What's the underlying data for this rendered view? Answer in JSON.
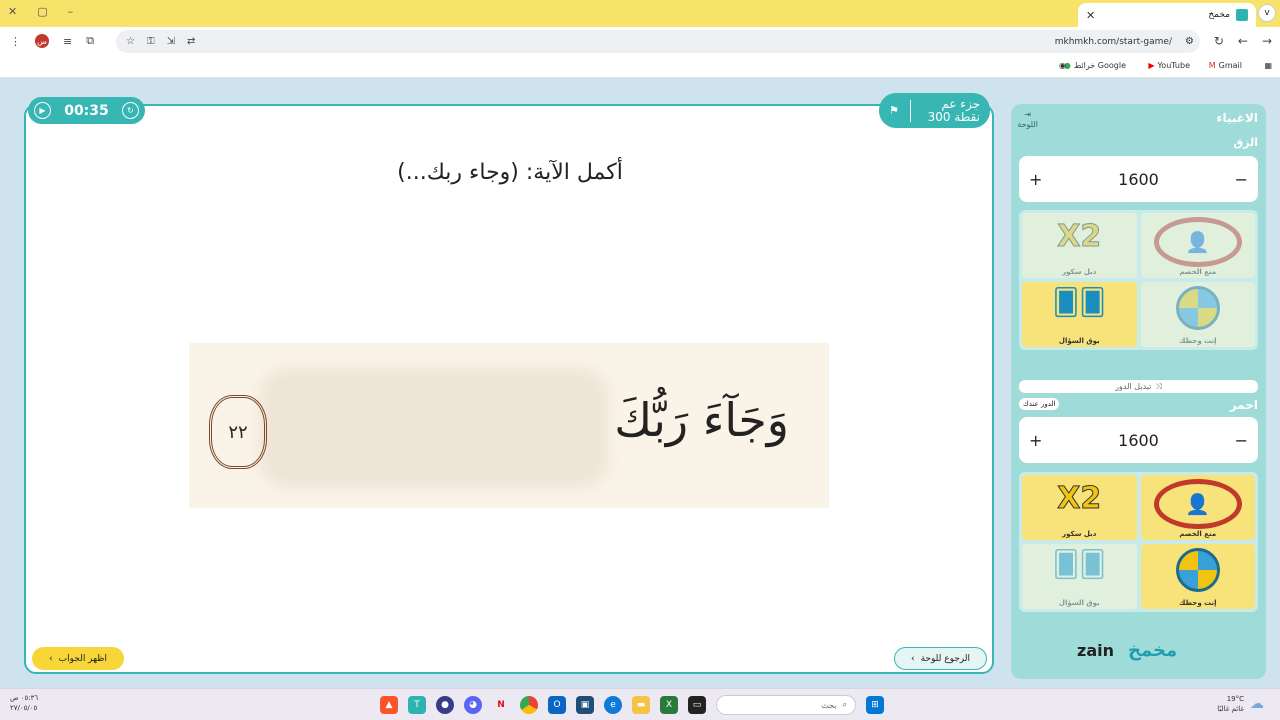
{
  "browser": {
    "tab_title": "مخمخ",
    "tab_profile": "v",
    "url": "mkhmkh.com/start-game/",
    "avatar_letter": "س",
    "bookmarks": [
      {
        "label": "Gmail",
        "icon": "gmail-icon"
      },
      {
        "label": "YouTube",
        "icon": "youtube-icon"
      },
      {
        "label": "خرائط Google",
        "icon": "maps-icon"
      }
    ]
  },
  "game": {
    "timer": "00:35",
    "category_name": "جزء عم",
    "category_points": "300 نقطة",
    "question": "أكمل الآية: (وجاء ربك...)",
    "verse_text": "وَجَآءَ رَبُّكَ",
    "verse_number": "٢٢",
    "show_answer_label": "اظهر الجواب",
    "back_label": "الرجوع للوحة"
  },
  "sidebar": {
    "back_board_label": "اللوحة",
    "team1": {
      "name": "الاغبياء",
      "subtitle": "الزق",
      "score": "1600",
      "aids": [
        {
          "label": "دبل سكور",
          "icon": "x2-icon",
          "used": true
        },
        {
          "label": "منع الخصم",
          "icon": "block-opponent-icon",
          "used": true
        },
        {
          "label": "بوق السؤال",
          "icon": "question-cards-icon",
          "used": false
        },
        {
          "label": "إنت وحظك",
          "icon": "luck-wheel-icon",
          "used": true
        }
      ]
    },
    "switch_turn_label": "تبديل الدور",
    "team2": {
      "name": "احمر",
      "turn_badge": "الدور عندك",
      "score": "1600",
      "aids": [
        {
          "label": "دبل سكور",
          "icon": "x2-icon",
          "used": false
        },
        {
          "label": "منع الخصم",
          "icon": "block-opponent-icon",
          "used": false
        },
        {
          "label": "بوق السؤال",
          "icon": "question-cards-icon",
          "used": true
        },
        {
          "label": "إنت وحظك",
          "icon": "luck-wheel-icon",
          "used": false
        }
      ]
    },
    "sponsor": "zain",
    "brand": "مخمخ"
  },
  "taskbar": {
    "time": "٠٥:٣٦ ص",
    "date": "٢٧/٠٥/٠٥",
    "search_placeholder": "بحث",
    "weather_temp": "19°C",
    "weather_desc": "غائم غالبًا"
  }
}
